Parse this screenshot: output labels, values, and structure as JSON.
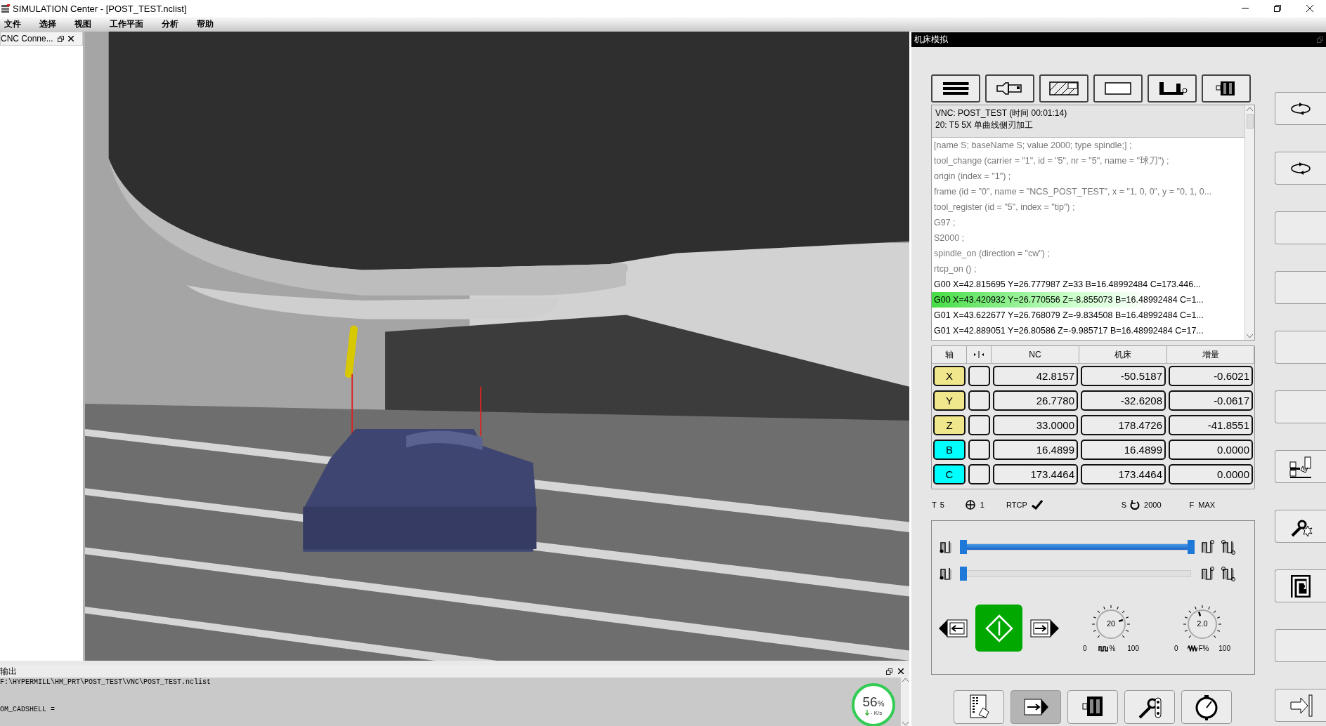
{
  "window": {
    "title": "SIMULATION Center - [POST_TEST.nclist]"
  },
  "menu": [
    "文件",
    "选择",
    "视图",
    "工作平面",
    "分析",
    "帮助"
  ],
  "left_panel": {
    "tab": "CNC Conne..."
  },
  "simulation_panel": {
    "title": "机床模拟",
    "program": {
      "header": [
        "VNC: POST_TEST (时间 00:01:14)",
        "20: T5 5X 单曲线侧刃加工"
      ],
      "lines": [
        {
          "text": "[name S; baseName S; value 2000; type spindle;] ;",
          "kind": "info",
          "selected": false
        },
        {
          "text": "tool_change (carrier = \"1\", id = \"5\", nr = \"5\", name = \"球刀\") ;",
          "kind": "info",
          "selected": false
        },
        {
          "text": "origin (index = \"1\") ;",
          "kind": "info",
          "selected": false
        },
        {
          "text": "frame (id = \"0\", name = \"NCS_POST_TEST\", x = \"1, 0, 0\", y = \"0, 1, 0...",
          "kind": "info",
          "selected": false
        },
        {
          "text": "tool_register (id = \"5\", index = \"tip\") ;",
          "kind": "info",
          "selected": false
        },
        {
          "text": "G97  ;",
          "kind": "info",
          "selected": false
        },
        {
          "text": "S2000 ;",
          "kind": "info",
          "selected": false
        },
        {
          "text": "spindle_on (direction = \"cw\") ;",
          "kind": "info",
          "selected": false
        },
        {
          "text": "rtcp_on () ;",
          "kind": "info",
          "selected": false
        },
        {
          "text": "G00 X=42.815695 Y=26.777987 Z=33 B=16.48992484 C=173.446...",
          "kind": "move",
          "selected": false
        },
        {
          "text": "G00 X=43.420932 Y=26.770556 Z=-8.855073 B=16.48992484 C=1...",
          "kind": "move",
          "selected": true
        },
        {
          "text": "G01 X=43.622677 Y=26.768079 Z=-9.834508 B=16.48992484 C=1...",
          "kind": "move",
          "selected": false
        },
        {
          "text": "G01 X=42.889051 Y=26.80586 Z=-9.985717 B=16.48992484 C=17...",
          "kind": "move",
          "selected": false
        }
      ]
    },
    "axes": {
      "columns": [
        "轴",
        "NC",
        "机床",
        "增量"
      ],
      "rows": [
        {
          "axis": "X",
          "color": "#f0e68c",
          "nc": "42.8157",
          "machine": "-50.5187",
          "delta": "-0.6021"
        },
        {
          "axis": "Y",
          "color": "#f0e68c",
          "nc": "26.7780",
          "machine": "-32.6208",
          "delta": "-0.0617"
        },
        {
          "axis": "Z",
          "color": "#f0e68c",
          "nc": "33.0000",
          "machine": "178.4726",
          "delta": "-41.8551"
        },
        {
          "axis": "B",
          "color": "#00ffff",
          "nc": "16.4899",
          "machine": "16.4899",
          "delta": "0.0000"
        },
        {
          "axis": "C",
          "color": "#00ffff",
          "nc": "173.4464",
          "machine": "173.4464",
          "delta": "0.0000"
        }
      ]
    },
    "status": {
      "tool_label": "T",
      "tool": "5",
      "origin": "1",
      "rtcp_label": "RTCP",
      "rtcp_checked": true,
      "spindle_label": "S",
      "spindle": "2000",
      "feed_label": "F",
      "feed": "MAX"
    },
    "sliders": [
      {
        "level": 1
      },
      {
        "level": 0
      }
    ],
    "dials": [
      {
        "value": "20",
        "min": "0",
        "unit": "%",
        "max": "100",
        "kind": "spindle"
      },
      {
        "value": "2.0",
        "min": "0",
        "unit": "F%",
        "max": "100",
        "kind": "feed"
      }
    ],
    "bottom_buttons": [
      {
        "kind": "program",
        "selected": false
      },
      {
        "kind": "step",
        "selected": true
      },
      {
        "kind": "machine",
        "selected": false
      },
      {
        "kind": "tooling",
        "selected": false
      },
      {
        "kind": "gauge",
        "selected": false
      }
    ],
    "side_buttons": [
      {
        "kind": "rotate"
      },
      {
        "kind": "rotate"
      },
      {
        "kind": "empty"
      },
      {
        "kind": "empty"
      },
      {
        "kind": "empty"
      },
      {
        "kind": "empty"
      },
      {
        "kind": "collision"
      },
      {
        "kind": "tool"
      },
      {
        "kind": "spiral"
      },
      {
        "kind": "empty"
      },
      {
        "kind": "stepin"
      }
    ]
  },
  "output": {
    "title": "输出",
    "lines": [
      "F:\\HYPERMILL\\HM_PRT\\POST_TEST\\VNC\\POST_TEST.nclist",
      "OM_CADSHELL ="
    ]
  },
  "speed_widget": {
    "percent": "56",
    "unit": "%",
    "rate": "- K/s"
  }
}
